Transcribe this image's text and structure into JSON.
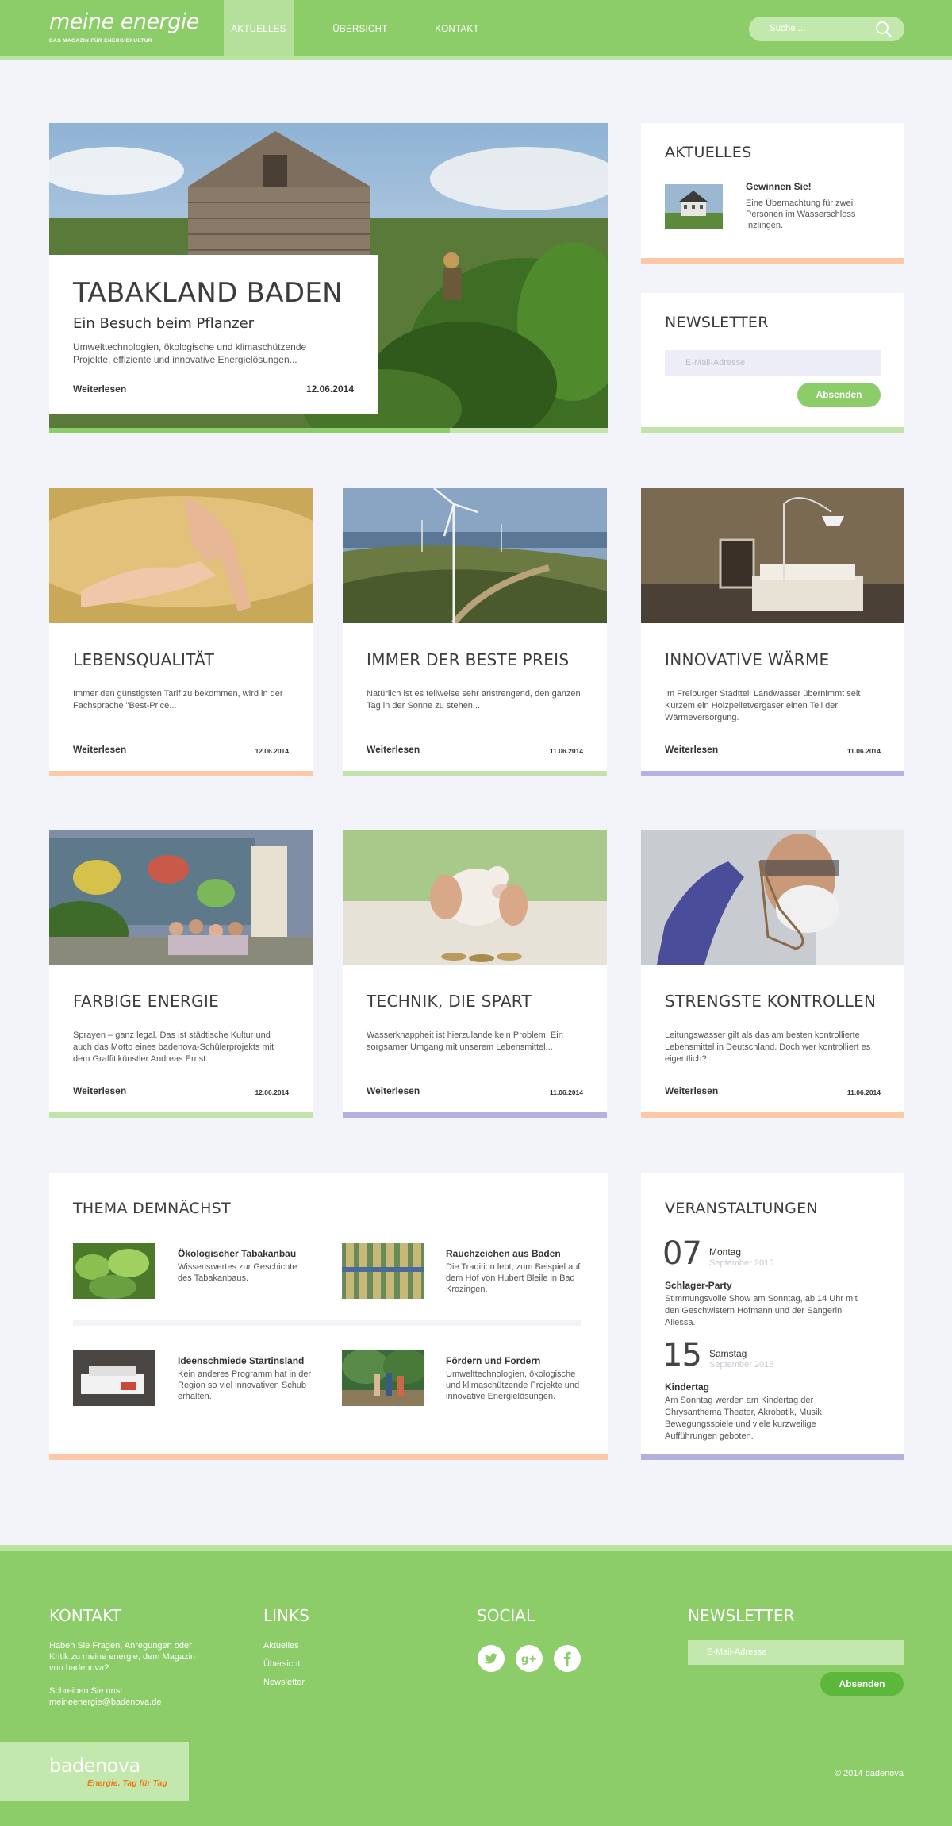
{
  "header": {
    "logo": "meine energie",
    "tagline": "DAS MAGAZIN FÜR ENERGIEKULTUR",
    "nav": [
      "AKTUELLES",
      "ÜBERSICHT",
      "KONTAKT"
    ],
    "search_placeholder": "Suche ...",
    "accent": "#8ccd6a"
  },
  "hero": {
    "title": "TABAKLAND BADEN",
    "subtitle": "Ein Besuch beim Pflanzer",
    "text": "Umwelttechnologien, ökologische und klimaschützende Projekte, effiziente und innovative Energielösungen...",
    "more": "Weiterlesen",
    "date": "12.06.2014"
  },
  "aktuelles": {
    "title": "AKTUELLES",
    "item_title": "Gewinnen Sie!",
    "item_text": "Eine Übernachtung für zwei Personen im Wasserschloss Inzlingen."
  },
  "newsletter": {
    "title": "NEWSLETTER",
    "placeholder": "E-Mail-Adresse",
    "button": "Absenden"
  },
  "cards": [
    {
      "title": "LEBENSQUALITÄT",
      "text": "Immer den günstigsten Tarif zu bekommen, wird in der Fachsprache \"Best-Price...",
      "more": "Weiterlesen",
      "date": "12.06.2014",
      "color": "#fcc8a6"
    },
    {
      "title": "IMMER DER BESTE PREIS",
      "text": "Natürlich ist es teilweise sehr anstrengend, den ganzen Tag in der Sonne zu stehen...",
      "more": "Weiterlesen",
      "date": "11.06.2014",
      "color": "#c3e3ad"
    },
    {
      "title": "INNOVATIVE WÄRME",
      "text": "Im Freiburger Stadtteil Landwasser übernimmt seit Kurzem ein Holzpelletvergaser einen Teil der Wärmeversorgung.",
      "more": "Weiterlesen",
      "date": "11.06.2014",
      "color": "#b3b1e2"
    },
    {
      "title": "FARBIGE ENERGIE",
      "text": "Sprayen – ganz legal. Das ist städtische Kultur und auch das Motto eines badenova-Schülerprojekts mit dem Graffitikünstler Andreas Ernst.",
      "more": "Weiterlesen",
      "date": "12.06.2014",
      "color": "#c3e3ad"
    },
    {
      "title": "TECHNIK, DIE SPART",
      "text": "Wasserknappheit ist hierzulande kein Problem. Ein sorgsamer Umgang mit unserem Lebensmittel...",
      "more": "Weiterlesen",
      "date": "11.06.2014",
      "color": "#b3b1e2"
    },
    {
      "title": "STRENGSTE KONTROLLEN",
      "text": "Leitungswasser gilt als das am besten kontrollierte Lebensmittel in Deutschland. Doch wer kontrolliert es eigentlich?",
      "more": "Weiterlesen",
      "date": "11.06.2014",
      "color": "#fcc8a6"
    }
  ],
  "thema": {
    "title": "THEMA DEMNÄCHST",
    "items": [
      {
        "title": "Ökologischer Tabakanbau",
        "text": "Wissenswertes zur Geschichte des Tabakanbaus."
      },
      {
        "title": "Rauchzeichen aus Baden",
        "text": "Die Tradition lebt, zum Beispiel auf dem Hof von Hubert Bleile in Bad Krozingen."
      },
      {
        "title": "Ideenschmiede Startinsland",
        "text": "Kein anderes Programm hat in der Region so viel innovativen Schub erhalten."
      },
      {
        "title": "Fördern und Fordern",
        "text": "Umwelttechnologien, ökologische und klimaschützende Projekte und innovative Energielösungen."
      }
    ]
  },
  "events": {
    "title": "VERANSTALTUNGEN",
    "items": [
      {
        "day": "07",
        "weekday": "Montag",
        "month": "September 2015",
        "title": "Schlager-Party",
        "text": "Stimmungsvolle Show am Sonntag, ab 14 Uhr mit den Geschwistern Hofmann und der Sängerin Allessa."
      },
      {
        "day": "15",
        "weekday": "Samstag",
        "month": "September 2015",
        "title": "Kindertag",
        "text": "Am Sonntag werden am Kindertag der Chrysanthema Theater, Akrobatik, Musik, Bewegungsspiele und viele kurzweilige Aufführungen geboten."
      }
    ]
  },
  "footer": {
    "kontakt_title": "KONTAKT",
    "kontakt_text": "Haben Sie Fragen, Anregungen oder Kritik zu meine energie, dem Magazin von badenova?",
    "kontakt_cta": "Schreiben Sie uns!",
    "kontakt_email": "meineenergie@badenova.de",
    "links_title": "LINKS",
    "links": [
      "Aktuelles",
      "Übersicht",
      "Newsletter"
    ],
    "social_title": "SOCIAL",
    "social_icons": [
      "twitter-icon",
      "google-plus-icon",
      "facebook-icon"
    ],
    "newsletter_title": "NEWSLETTER",
    "newsletter_placeholder": "E-Mail-Adresse",
    "newsletter_button": "Absenden",
    "brand": "badenova",
    "brand_slogan": "Energie. Tag für Tag",
    "copyright": "© 2014 badenova"
  }
}
